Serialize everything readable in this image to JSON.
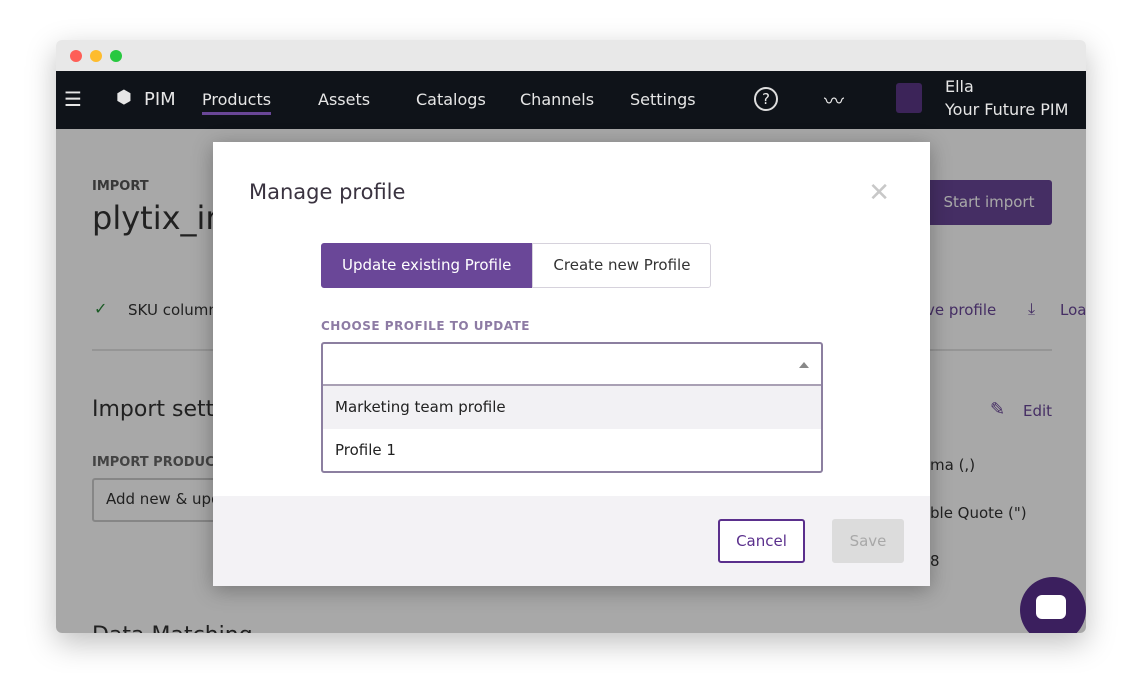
{
  "nav": {
    "app": "PIM",
    "items": [
      "Products",
      "Assets",
      "Catalogs",
      "Channels",
      "Settings"
    ],
    "active": "Products",
    "user_name": "Ella",
    "user_org": "Your Future PIM"
  },
  "page": {
    "eyebrow": "IMPORT",
    "title": "plytix_im",
    "start_import": "Start import",
    "sku_status": "SKU column",
    "save_profile": "ve profile",
    "load": "Loa",
    "settings_heading": "Import setti",
    "edit": "Edit",
    "import_products_label": "IMPORT PRODUC",
    "import_mode": "Add new & upd",
    "separator": "ma (,)",
    "quote": "ble Quote (\")",
    "encoding": "8",
    "data_matching": "Data Matching"
  },
  "modal": {
    "title": "Manage profile",
    "tabs": [
      "Update existing Profile",
      "Create new Profile"
    ],
    "active_tab": "Update existing Profile",
    "field_label": "CHOOSE PROFILE TO UPDATE",
    "field_value": "",
    "options": [
      "Marketing team profile",
      "Profile 1"
    ],
    "highlighted": "Marketing team profile",
    "cancel": "Cancel",
    "save": "Save"
  },
  "colors": {
    "accent": "#6a4798",
    "nav_bg": "#0f1319"
  }
}
